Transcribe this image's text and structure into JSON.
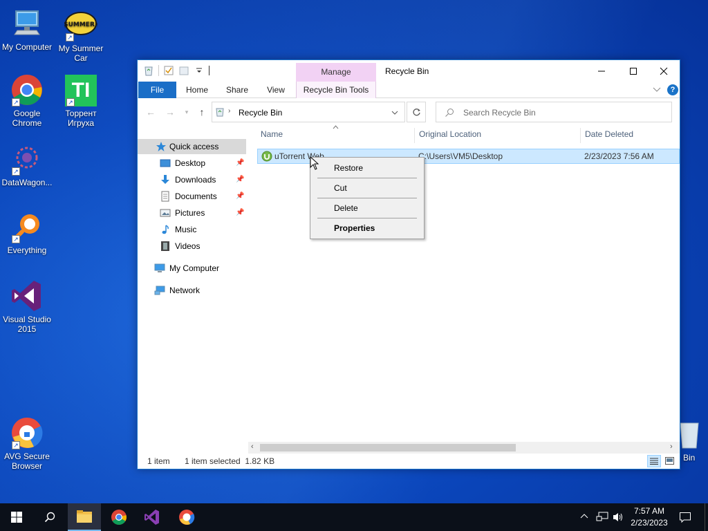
{
  "desktop": {
    "icons": [
      {
        "label": "My Computer"
      },
      {
        "label": "My Summer Car",
        "logo_text": "MY SUMMER CAR"
      },
      {
        "label": "Google Chrome"
      },
      {
        "label": "Торрент Игруха",
        "logo_text": "TI"
      },
      {
        "label": "DataWagon..."
      },
      {
        "label": "Everything"
      },
      {
        "label": "Visual Studio 2015"
      },
      {
        "label": "AVG Secure Browser"
      },
      {
        "label": "Bin"
      }
    ]
  },
  "window": {
    "title": "Recycle Bin",
    "contextual_group": "Manage",
    "ribbon_tabs": [
      "File",
      "Home",
      "Share",
      "View",
      "Recycle Bin Tools"
    ],
    "address": {
      "path": "Recycle Bin"
    },
    "search": {
      "placeholder": "Search Recycle Bin"
    },
    "nav": {
      "items": [
        "Quick access",
        "Desktop",
        "Downloads",
        "Documents",
        "Pictures",
        "Music",
        "Videos",
        "My Computer",
        "Network"
      ]
    },
    "columns": [
      "Name",
      "Original Location",
      "Date Deleted"
    ],
    "files": [
      {
        "name": "uTorrent Web",
        "location": "C:\\Users\\VM5\\Desktop",
        "date": "2/23/2023 7:56 AM"
      }
    ],
    "status": {
      "count": "1 item",
      "selected": "1 item selected  1.82 KB"
    }
  },
  "context_menu": {
    "items": [
      "Restore",
      "Cut",
      "Delete",
      "Properties"
    ]
  },
  "taskbar": {
    "time": "7:57 AM",
    "date": "2/23/2023"
  },
  "colors": {
    "accent": "#1a6ec7",
    "manage_tab": "#f2d2f4",
    "selection": "#cce8ff",
    "taskbar": "#0b1019"
  }
}
